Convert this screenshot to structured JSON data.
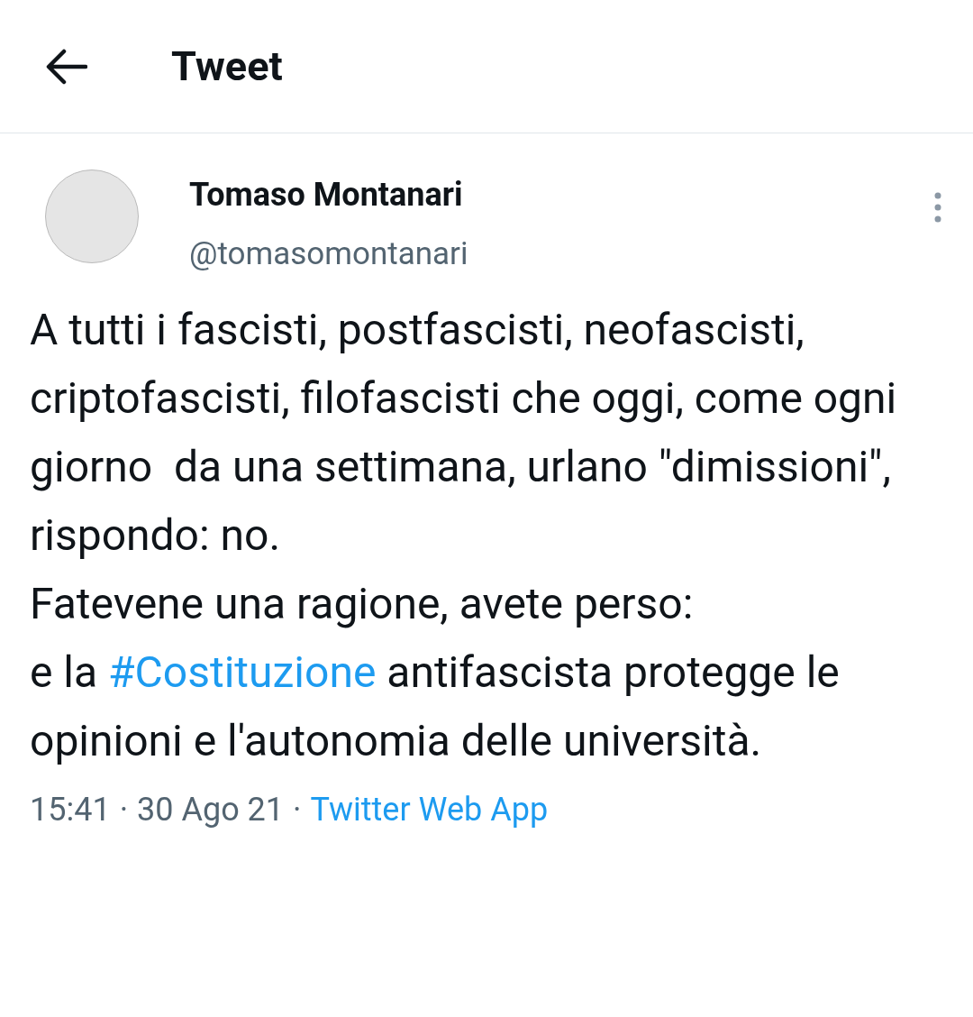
{
  "header": {
    "title": "Tweet"
  },
  "tweet": {
    "author": {
      "name": "Tomaso Montanari",
      "handle": "@tomasomontanari"
    },
    "body": [
      {
        "kind": "text",
        "text": "A tutti i fascisti, postfascisti, neofascisti, criptofascisti, filofascisti che oggi, come ogni giorno  da una settimana, urlano \"dimissioni\", rispondo: no.\nFatevene una ragione, avete perso:\ne la "
      },
      {
        "kind": "hashtag",
        "text": "#Costituzione"
      },
      {
        "kind": "text",
        "text": " antifascista protegge le opinioni e l'autonomia delle università."
      }
    ],
    "meta": {
      "time": "15:41",
      "separator": "·",
      "date": "30 Ago 21",
      "source": "Twitter Web App"
    }
  }
}
